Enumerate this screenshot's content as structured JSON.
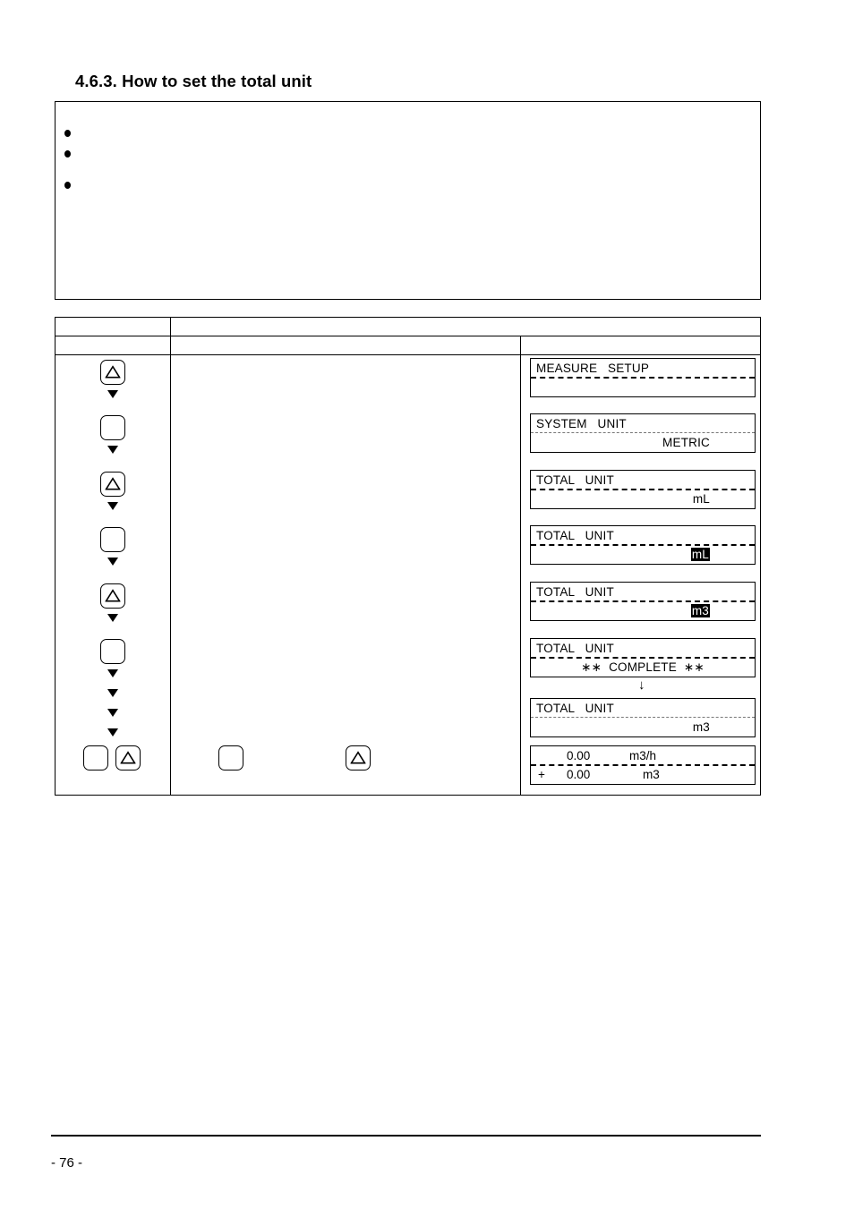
{
  "page": {
    "heading": "4.6.3. How to set the total unit",
    "page_number": "- 76 -"
  },
  "note_box": {
    "bullets": [
      "",
      "",
      ""
    ]
  },
  "procedure_table": {
    "header_row_1": [
      "",
      ""
    ],
    "header_row_2": [
      "",
      "",
      ""
    ],
    "key_column_label": "",
    "description_column_label": "",
    "display_column_label": ""
  },
  "keys": [
    {
      "name": "key-up-triangle-1",
      "icon": "triangle-up-icon",
      "label": ""
    },
    {
      "name": "key-blank-1",
      "icon": "blank-key-icon",
      "label": ""
    },
    {
      "name": "key-up-triangle-2",
      "icon": "triangle-up-icon",
      "label": ""
    },
    {
      "name": "key-blank-2",
      "icon": "blank-key-icon",
      "label": ""
    },
    {
      "name": "key-up-triangle-3",
      "icon": "triangle-up-icon",
      "label": ""
    },
    {
      "name": "key-blank-3",
      "icon": "blank-key-icon",
      "label": ""
    },
    {
      "name": "key-blank-4",
      "icon": "blank-key-icon",
      "label": ""
    },
    {
      "name": "key-up-triangle-4",
      "icon": "triangle-up-icon",
      "label": ""
    }
  ],
  "middle_keys": [
    {
      "name": "key-blank-mid",
      "icon": "blank-key-icon",
      "label": ""
    },
    {
      "name": "key-up-triangle-mid",
      "icon": "triangle-up-icon",
      "label": ""
    }
  ],
  "displays": [
    {
      "id": "display-measure-setup",
      "line1": "MEASURE   SETUP",
      "line2": "",
      "line1_align": "left",
      "line2_align": "left",
      "separator": "thick",
      "line2_inverted": false
    },
    {
      "id": "display-system-unit",
      "line1": "SYSTEM   UNIT",
      "line2": "METRIC",
      "line1_align": "left",
      "line2_align": "right",
      "separator": "thin",
      "line2_inverted": false
    },
    {
      "id": "display-total-unit-ml",
      "line1": "TOTAL   UNIT",
      "line2": "mL",
      "line1_align": "left",
      "line2_align": "right",
      "separator": "thick",
      "line2_inverted": false
    },
    {
      "id": "display-total-unit-ml-selected",
      "line1": "TOTAL   UNIT",
      "line2": "mL",
      "line1_align": "left",
      "line2_align": "right",
      "separator": "thick",
      "line2_inverted": true
    },
    {
      "id": "display-total-unit-m3-selected",
      "line1": "TOTAL   UNIT",
      "line2": "m3",
      "line1_align": "left",
      "line2_align": "right",
      "separator": "thick",
      "line2_inverted": true
    },
    {
      "id": "display-total-unit-complete",
      "line1": "TOTAL   UNIT",
      "line2": "∗∗  COMPLETE  ∗∗",
      "line1_align": "left",
      "line2_align": "center",
      "separator": "thick",
      "line2_inverted": false
    },
    {
      "id": "display-total-unit-m3",
      "line1": "TOTAL   UNIT",
      "line2": "m3",
      "line1_align": "left",
      "line2_align": "right",
      "separator": "thin",
      "line2_inverted": false
    }
  ],
  "transition_arrow": "↓",
  "flow_display": {
    "id": "display-flow-total",
    "rate_value": "0.00",
    "rate_unit": "m3/h",
    "total_sign": "+",
    "total_value": "0.00",
    "total_unit": "m3"
  }
}
